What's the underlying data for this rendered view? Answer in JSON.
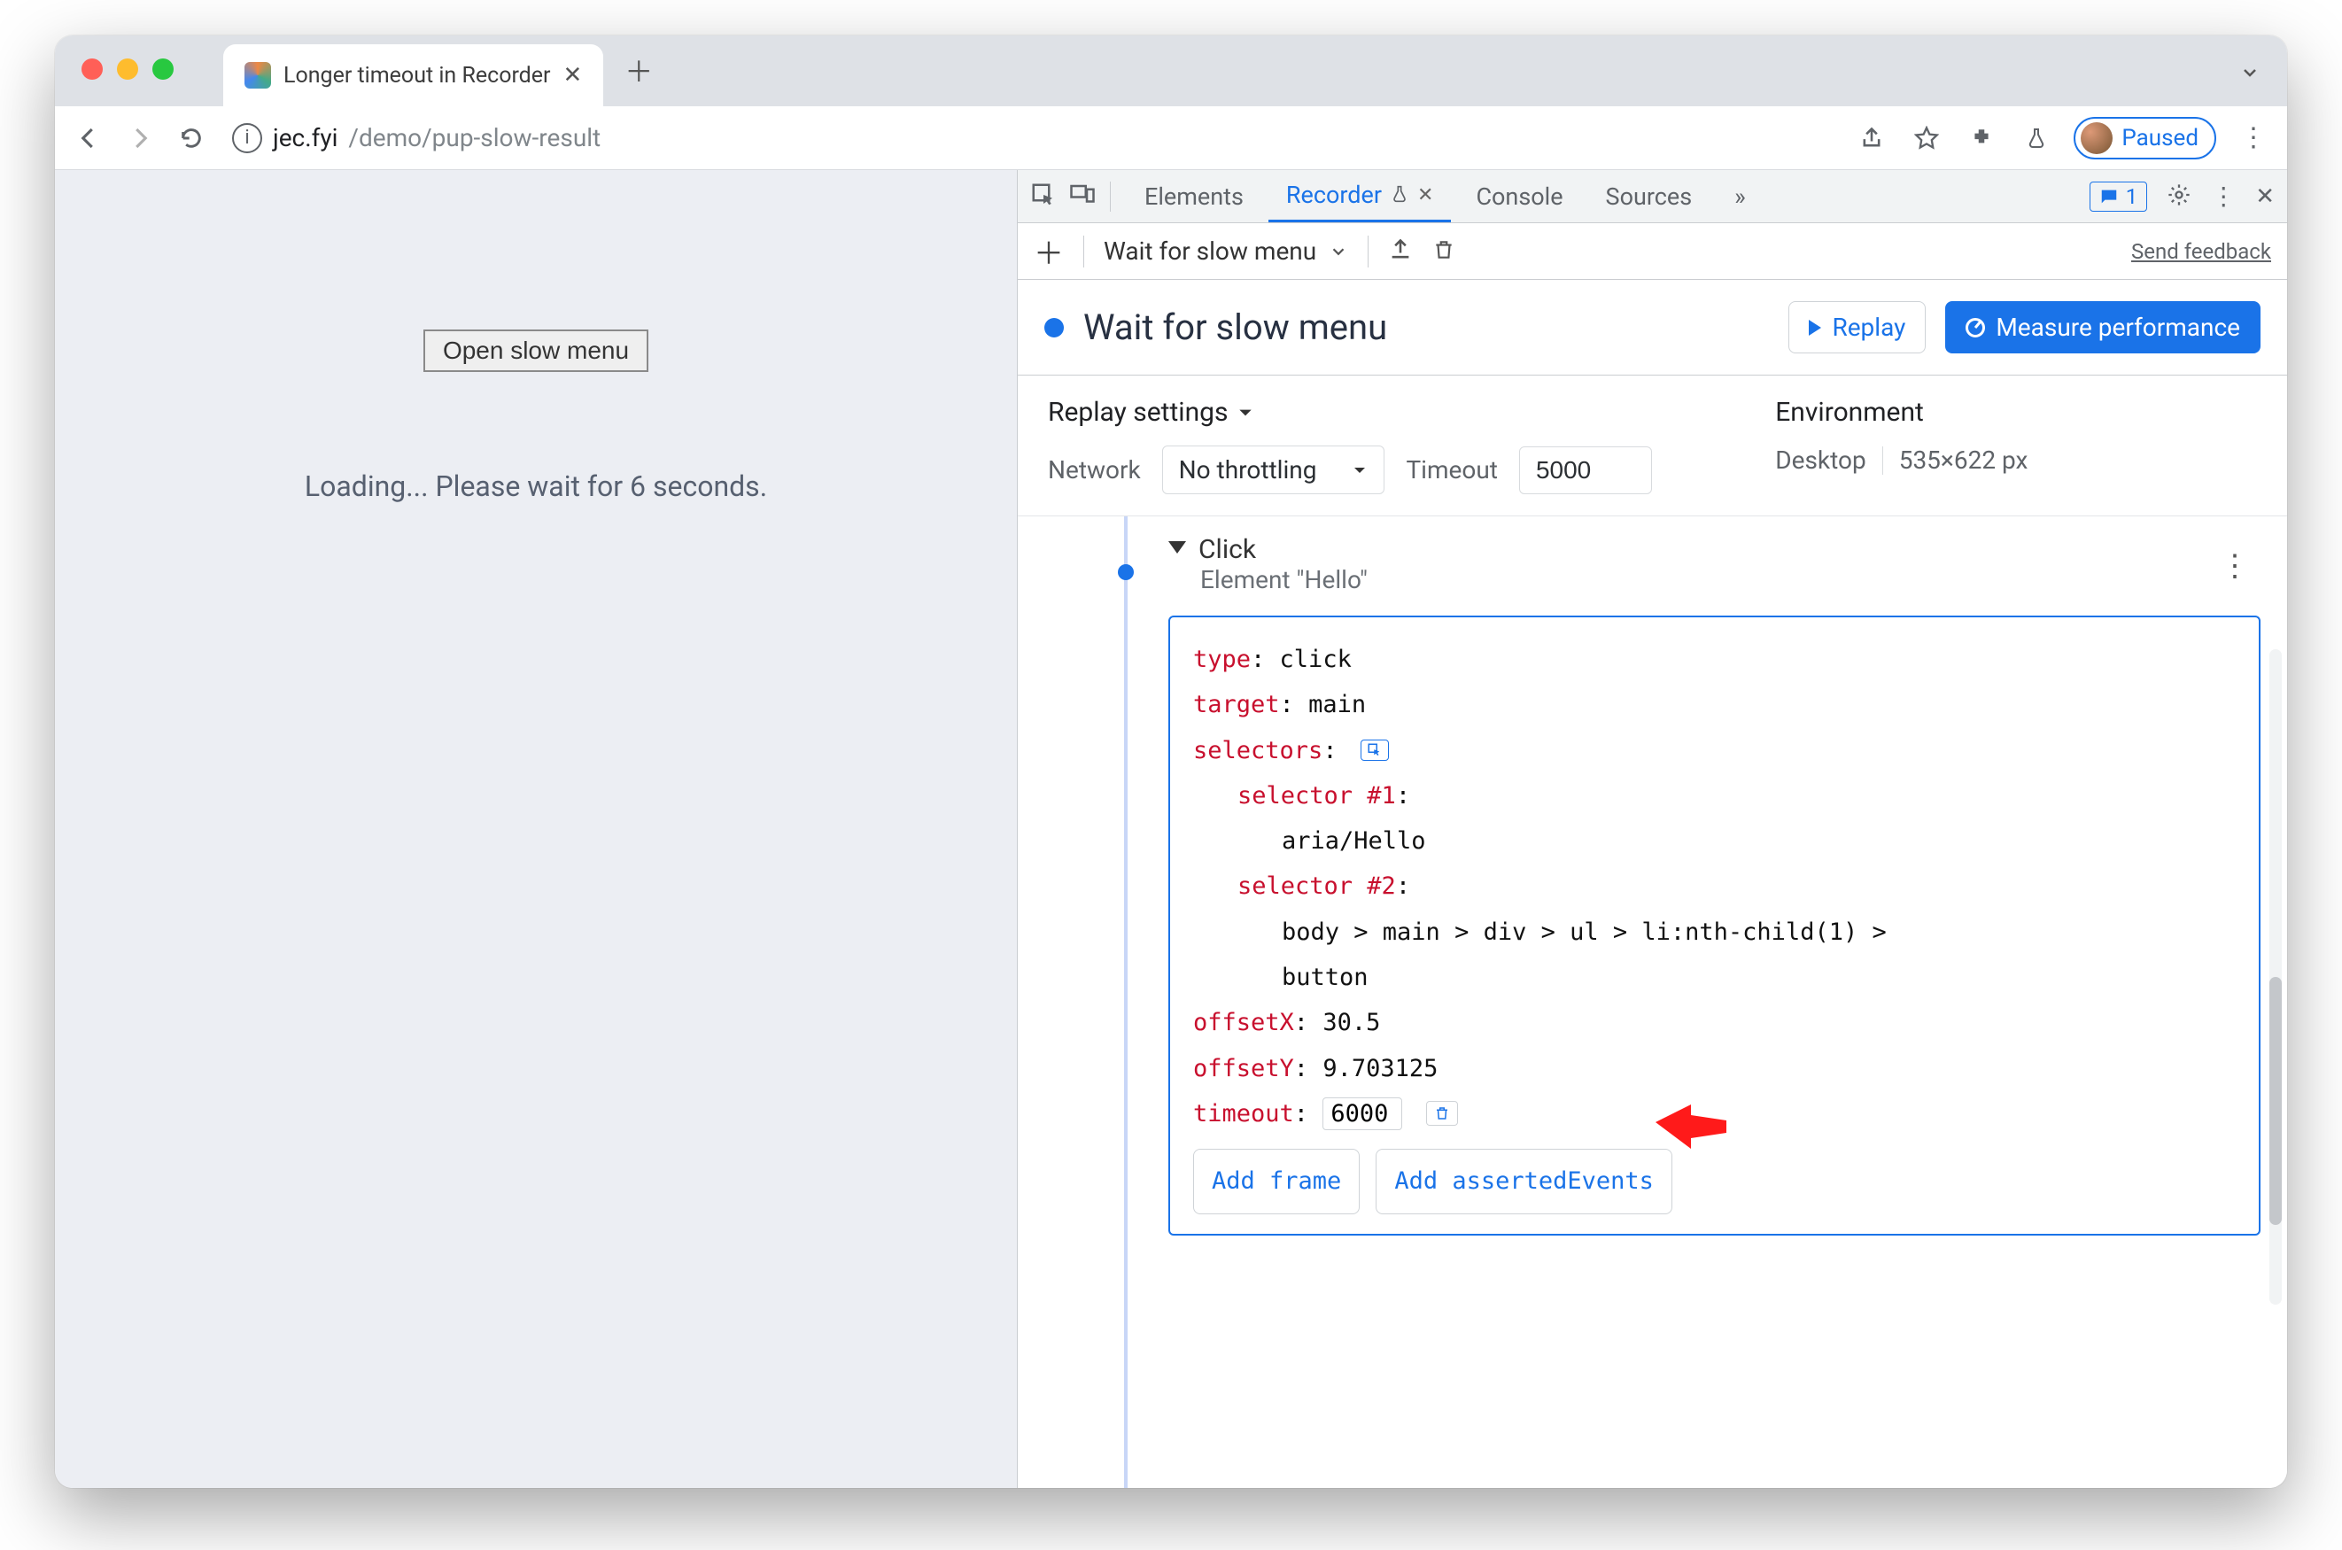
{
  "browser": {
    "tab_title": "Longer timeout in Recorder",
    "url_domain": "jec.fyi",
    "url_path": "/demo/pup-slow-result",
    "paused_label": "Paused"
  },
  "page": {
    "open_button": "Open slow menu",
    "loading": "Loading... Please wait for 6 seconds."
  },
  "devtools": {
    "tabs": {
      "elements": "Elements",
      "recorder": "Recorder",
      "console": "Console",
      "sources": "Sources"
    },
    "issues_count": "1",
    "toolbar": {
      "recording_selector": "Wait for slow menu",
      "send_feedback": "Send feedback"
    },
    "title": "Wait for slow menu",
    "replay_btn": "Replay",
    "measure_btn": "Measure performance",
    "replay_settings": {
      "heading": "Replay settings",
      "network_label": "Network",
      "network_value": "No throttling",
      "timeout_label": "Timeout",
      "timeout_value": "5000"
    },
    "environment": {
      "heading": "Environment",
      "device": "Desktop",
      "dims": "535×622 px"
    },
    "step": {
      "name": "Click",
      "subtitle": "Element \"Hello\"",
      "type_k": "type",
      "type_v": "click",
      "target_k": "target",
      "target_v": "main",
      "selectors_k": "selectors",
      "sel1_k": "selector #1",
      "sel1_v": "aria/Hello",
      "sel2_k": "selector #2",
      "sel2_v": "body > main > div > ul > li:nth-child(1) > button",
      "offx_k": "offsetX",
      "offx_v": "30.5",
      "offy_k": "offsetY",
      "offy_v": "9.703125",
      "timeout_k": "timeout",
      "timeout_v": "6000",
      "add_frame": "Add frame",
      "add_asserted": "Add assertedEvents"
    }
  }
}
